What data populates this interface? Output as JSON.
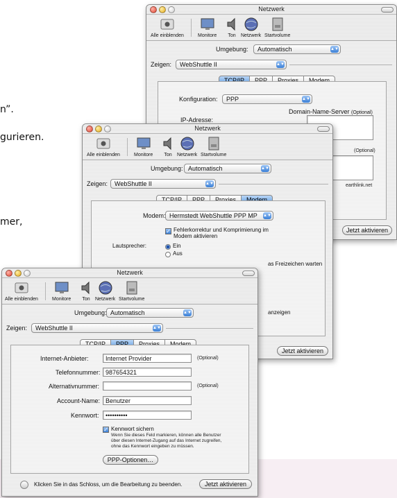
{
  "background_text": [
    {
      "text": "n”."
    },
    {
      "text": "gurieren."
    },
    {
      "text": "mer,"
    }
  ],
  "toolbar": {
    "show_all": "Alle einblenden",
    "monitore": "Monitore",
    "ton": "Ton",
    "netzwerk": "Netzwerk",
    "startvolume": "Startvolume"
  },
  "window_back": {
    "title": "Netzwerk",
    "umgebung_label": "Umgebung:",
    "umgebung_value": "Automatisch",
    "zeigen_label": "Zeigen:",
    "zeigen_value": "WebShuttle II",
    "tabs": [
      "TCP/IP",
      "PPP",
      "Proxies",
      "Modem"
    ],
    "active_tab": "TCP/IP",
    "konfiguration_label": "Konfiguration:",
    "konfiguration_value": "PPP",
    "ip_label": "IP-Adresse:",
    "dns_label": "Domain-Name-Server",
    "dns_optional": "(Optional)",
    "optional2": "(Optional)",
    "domain_tail": "earthlink.net",
    "apply_button": "Jetzt aktivieren"
  },
  "window_middle": {
    "title": "Netzwerk",
    "umgebung_label": "Umgebung:",
    "umgebung_value": "Automatisch",
    "zeigen_label": "Zeigen:",
    "zeigen_value": "WebShuttle II",
    "tabs": [
      "TCP/IP",
      "PPP",
      "Proxies",
      "Modem"
    ],
    "active_tab": "Modem",
    "modem_label": "Modem:",
    "modem_value": "Hermstedt WebShuttle PPP MP",
    "error_correction_line1": "Fehlerkorrektur und Komprimierung im",
    "error_correction_line2": "Modem aktivieren",
    "speaker_label": "Lautsprecher:",
    "speaker_on": "Ein",
    "speaker_off": "Aus",
    "dialtone_tail": "as Freizeichen warten",
    "show_tail": "anzeigen",
    "apply_button": "Jetzt aktivieren"
  },
  "window_front": {
    "title": "Netzwerk",
    "umgebung_label": "Umgebung:",
    "umgebung_value": "Automatisch",
    "zeigen_label": "Zeigen:",
    "zeigen_value": "WebShuttle II",
    "tabs": [
      "TCP/IP",
      "PPP",
      "Proxies",
      "Modem"
    ],
    "active_tab": "PPP",
    "provider_label": "Internet-Anbieter:",
    "provider_value": "Internet Provider",
    "provider_optional": "(Optional)",
    "phone_label": "Telefonnummer:",
    "phone_value": "987654321",
    "alt_label": "Alternativnummer:",
    "alt_value": "",
    "alt_optional": "(Optional)",
    "account_label": "Account-Name:",
    "account_value": "Benutzer",
    "password_label": "Kennwort:",
    "password_value": "••••••••••",
    "save_pw_label": "Kennwort sichern",
    "save_pw_help_line1": "Wenn Sie dieses Feld markieren, können alle Benutzer",
    "save_pw_help_line2": "über diesen Internet-Zugang auf das Internet zugreifen,",
    "save_pw_help_line3": "ohne das Kennwort eingeben zu müssen.",
    "ppp_options_button": "PPP-Optionen…",
    "lock_text": "Klicken Sie in das Schloss, um die Bearbeitung zu beenden.",
    "apply_button": "Jetzt aktivieren"
  }
}
